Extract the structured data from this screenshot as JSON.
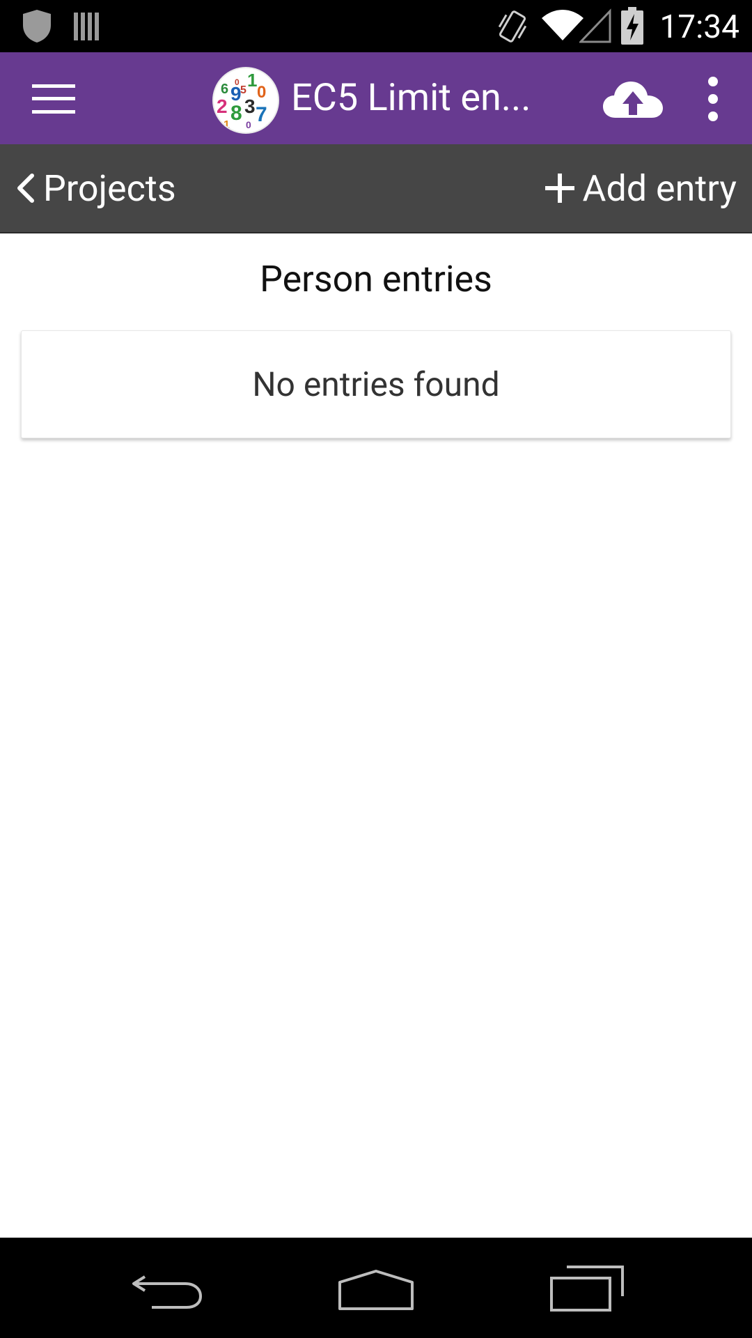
{
  "status_bar": {
    "time": "17:34",
    "icons": [
      "shield-icon",
      "sim-card-icon",
      "vibrate-icon",
      "wifi-icon",
      "cell-signal-icon",
      "battery-charging-icon"
    ]
  },
  "app_bar": {
    "title": "EC5 Limit en...",
    "menu_icon": "hamburger-menu-icon",
    "logo_icon": "numbers-logo-icon",
    "upload_icon": "cloud-upload-icon",
    "overflow_icon": "more-vert-icon"
  },
  "sub_bar": {
    "back_label": "Projects",
    "add_label": "Add entry"
  },
  "main": {
    "heading": "Person entries",
    "empty_message": "No entries found"
  },
  "nav_bar": {
    "icons": [
      "back-nav-icon",
      "home-nav-icon",
      "recents-nav-icon"
    ]
  },
  "colors": {
    "app_bar": "#673a90",
    "sub_bar": "#464646",
    "status_bar": "#000000",
    "nav_bar": "#000000"
  }
}
